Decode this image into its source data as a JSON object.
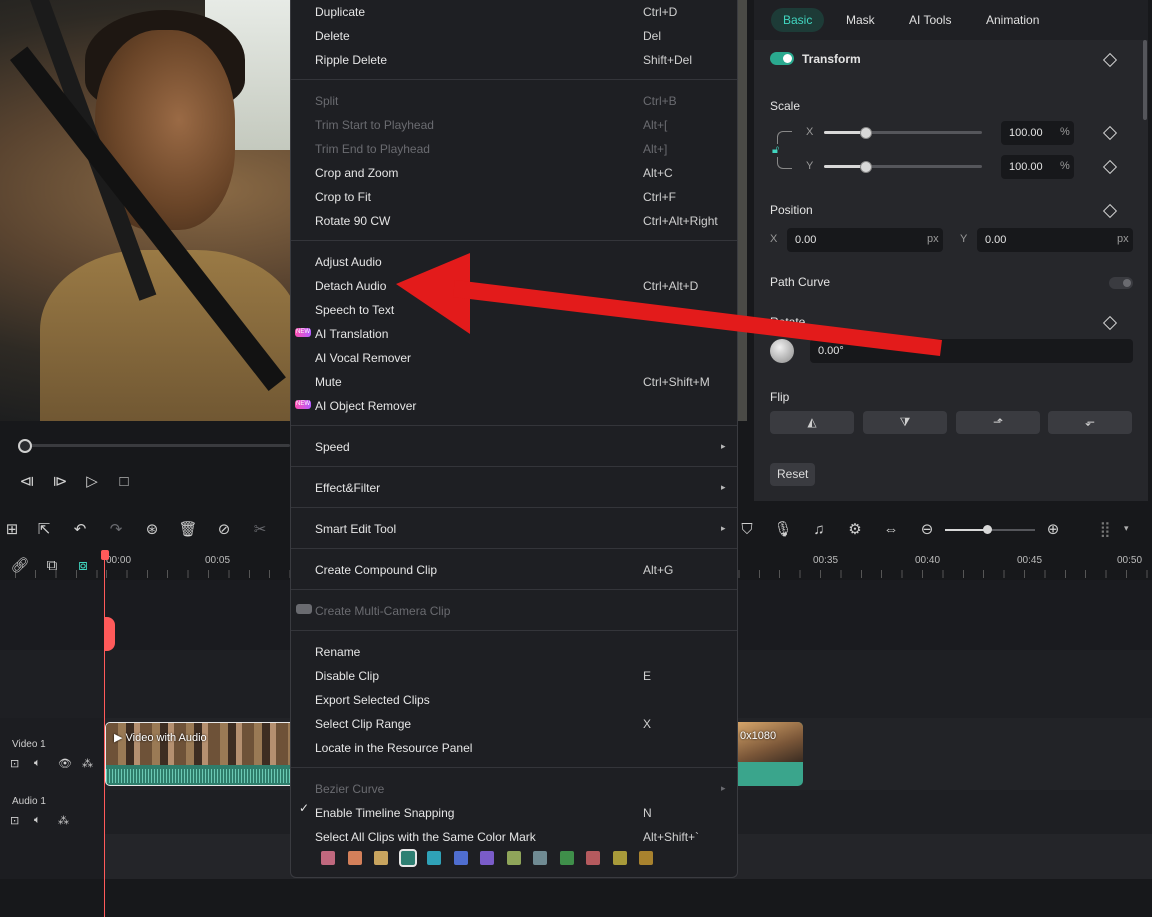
{
  "right_panel": {
    "tabs": [
      "Basic",
      "Mask",
      "AI Tools",
      "Animation"
    ],
    "transform_label": "Transform",
    "scale_label": "Scale",
    "scale_x_label": "X",
    "scale_x_value": "100.00",
    "scale_y_label": "Y",
    "scale_y_value": "100.00",
    "percent": "%",
    "position_label": "Position",
    "pos_x_label": "X",
    "pos_x_value": "0.00",
    "pos_y_label": "Y",
    "pos_y_value": "0.00",
    "px": "px",
    "path_curve_label": "Path Curve",
    "rotate_label": "Rotate",
    "rotate_value": "0.00°",
    "flip_label": "Flip",
    "reset_label": "Reset"
  },
  "timeline": {
    "ruler": [
      "00:00",
      "00:05",
      "00:35",
      "00:40",
      "00:45",
      "00:50"
    ],
    "video_track_label": "Video 1",
    "audio_track_label": "Audio 1",
    "clip1_label": "Video with Audio",
    "clip2_label": "0x1080"
  },
  "menu": {
    "items": [
      {
        "label": "Duplicate",
        "shortcut": "Ctrl+D"
      },
      {
        "label": "Delete",
        "shortcut": "Del"
      },
      {
        "label": "Ripple Delete",
        "shortcut": "Shift+Del"
      },
      {
        "label": "Split",
        "shortcut": "Ctrl+B"
      },
      {
        "label": "Trim Start to Playhead",
        "shortcut": "Alt+["
      },
      {
        "label": "Trim End to Playhead",
        "shortcut": "Alt+]"
      },
      {
        "label": "Crop and Zoom",
        "shortcut": "Alt+C"
      },
      {
        "label": "Crop to Fit",
        "shortcut": "Ctrl+F"
      },
      {
        "label": "Rotate 90 CW",
        "shortcut": "Ctrl+Alt+Right"
      },
      {
        "label": "Adjust Audio",
        "shortcut": ""
      },
      {
        "label": "Detach Audio",
        "shortcut": "Ctrl+Alt+D"
      },
      {
        "label": "Speech to Text",
        "shortcut": ""
      },
      {
        "label": "AI Translation",
        "shortcut": ""
      },
      {
        "label": "AI Vocal Remover",
        "shortcut": ""
      },
      {
        "label": "Mute",
        "shortcut": "Ctrl+Shift+M"
      },
      {
        "label": "AI Object Remover",
        "shortcut": ""
      },
      {
        "label": "Speed",
        "shortcut": ""
      },
      {
        "label": "Effect&Filter",
        "shortcut": ""
      },
      {
        "label": "Smart Edit Tool",
        "shortcut": ""
      },
      {
        "label": "Create Compound Clip",
        "shortcut": "Alt+G"
      },
      {
        "label": "Create Multi-Camera Clip",
        "shortcut": ""
      },
      {
        "label": "Rename",
        "shortcut": ""
      },
      {
        "label": "Disable Clip",
        "shortcut": "E"
      },
      {
        "label": "Export Selected Clips",
        "shortcut": ""
      },
      {
        "label": "Select Clip Range",
        "shortcut": "X"
      },
      {
        "label": "Locate in the Resource Panel",
        "shortcut": ""
      },
      {
        "label": "Bezier Curve",
        "shortcut": ""
      },
      {
        "label": "Enable Timeline Snapping",
        "shortcut": "N"
      },
      {
        "label": "Select All Clips with the Same Color Mark",
        "shortcut": "Alt+Shift+`"
      }
    ],
    "new_badge": "NEW",
    "color_marks": [
      "#c0687e",
      "#d4805a",
      "#c9a55f",
      "#2e7f72",
      "#2fa2b8",
      "#4f6ed0",
      "#7a5cc9",
      "#8fa55a",
      "#6f8a92",
      "#3f8f4a",
      "#b55a5e",
      "#a89a3a",
      "#a8822e"
    ]
  },
  "colors": {
    "accent": "#41d6c0",
    "arrow": "#e31b1b",
    "playhead": "#ff5a5a"
  }
}
